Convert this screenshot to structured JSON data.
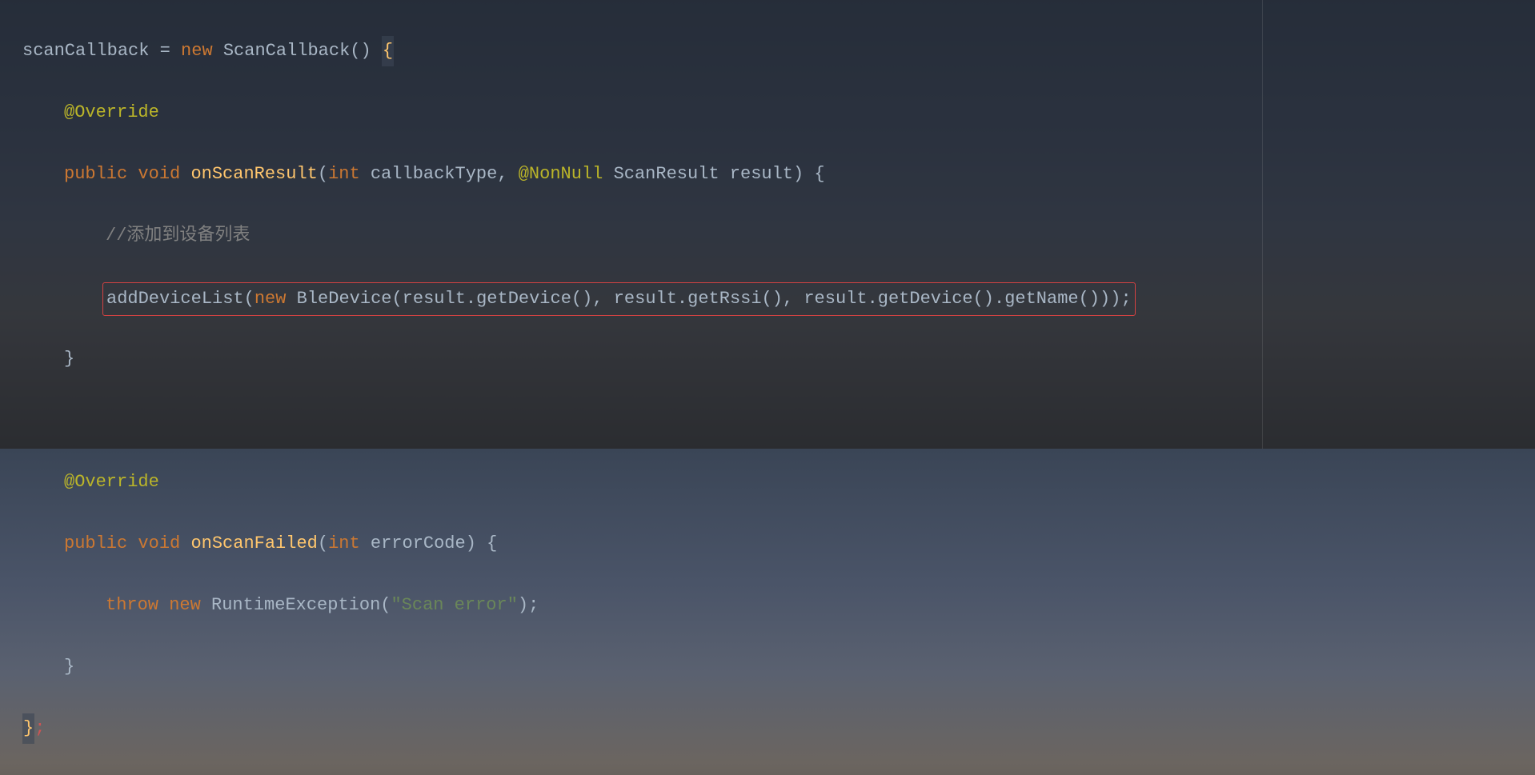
{
  "code": {
    "line1": {
      "var": "scanCallback",
      "eq": " = ",
      "new": "new",
      "type": "ScanCallback",
      "parens": "()",
      "brace": "{"
    },
    "line2": {
      "annotation": "@Override"
    },
    "line3": {
      "public": "public",
      "void": "void",
      "method": "onScanResult",
      "open": "(",
      "int": "int",
      "param1": "callbackType",
      "comma": ", ",
      "nonnull": "@NonNull",
      "type": "ScanResult",
      "param2": "result",
      "close": ")",
      "brace": "{"
    },
    "line4": {
      "comment": "//添加到设备列表"
    },
    "line5": {
      "call": "addDeviceList(",
      "new": "new",
      "type": "BleDevice(result.getDevice(), result.getRssi(), result.getDevice().getName()))",
      "semi": ";"
    },
    "line6": {
      "brace": "}"
    },
    "line8": {
      "annotation": "@Override"
    },
    "line9": {
      "public": "public",
      "void": "void",
      "method": "onScanFailed",
      "open": "(",
      "int": "int",
      "param": "errorCode",
      "close": ")",
      "brace": "{"
    },
    "line10": {
      "throw": "throw",
      "new": "new",
      "type": "RuntimeException(",
      "str": "\"Scan error\"",
      "close": ")",
      "semi": ";"
    },
    "line11": {
      "brace": "}"
    },
    "line12": {
      "brace": "}",
      "semi": ";"
    }
  }
}
